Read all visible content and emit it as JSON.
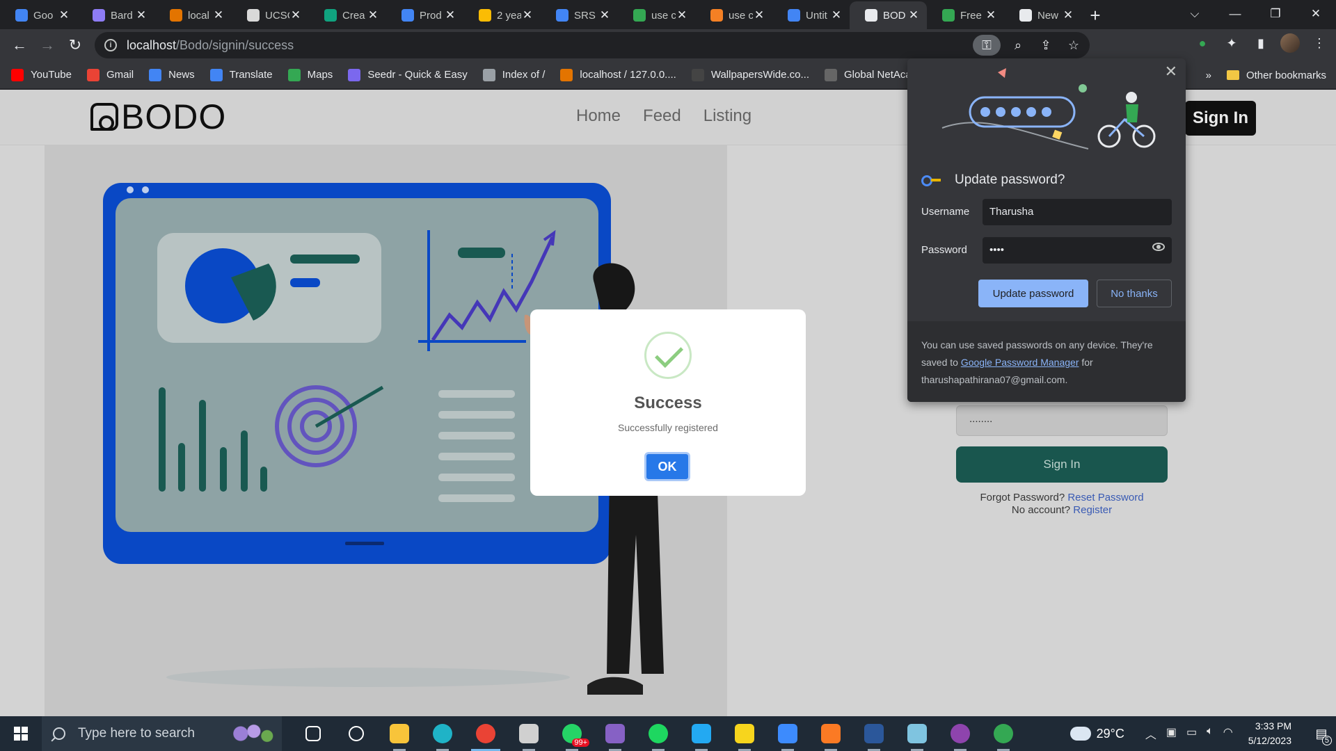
{
  "browser": {
    "tabs": [
      {
        "title": "Goo",
        "color": "#4285f4",
        "active": false
      },
      {
        "title": "Bard",
        "color": "#8e7cf5",
        "active": false
      },
      {
        "title": "local",
        "color": "#e37400",
        "active": false
      },
      {
        "title": "UCSC",
        "color": "#d9d9d9",
        "active": false
      },
      {
        "title": "Crea",
        "color": "#10a37f",
        "active": false
      },
      {
        "title": "Prod",
        "color": "#4285f4",
        "active": false
      },
      {
        "title": "2 yea",
        "color": "#fbbc04",
        "active": false
      },
      {
        "title": "SRS",
        "color": "#4285f4",
        "active": false
      },
      {
        "title": "use c",
        "color": "#34a853",
        "active": false
      },
      {
        "title": "use c",
        "color": "#f48024",
        "active": false
      },
      {
        "title": "Untit",
        "color": "#4285f4",
        "active": false
      },
      {
        "title": "BOD",
        "color": "#e8eaed",
        "active": true
      },
      {
        "title": "Free",
        "color": "#34a853",
        "active": false
      },
      {
        "title": "New",
        "color": "#e8eaed",
        "active": false
      }
    ],
    "new_tab_icon": "+",
    "window_controls": {
      "tab_search": "⌵",
      "minimize": "—",
      "restore": "❐",
      "close": "✕"
    },
    "nav": {
      "back": "←",
      "forward": "→",
      "reload": "↻"
    },
    "url_host": "localhost",
    "url_path": "/Bodo/signin/success",
    "bookmarks": [
      {
        "label": "YouTube",
        "color": "#ff0000"
      },
      {
        "label": "Gmail",
        "color": "#ea4335"
      },
      {
        "label": "News",
        "color": "#4285f4"
      },
      {
        "label": "Translate",
        "color": "#4285f4"
      },
      {
        "label": "Maps",
        "color": "#34a853"
      },
      {
        "label": "Seedr - Quick & Easy",
        "color": "#7b68ee"
      },
      {
        "label": "Index of /",
        "color": "#9aa0a6"
      },
      {
        "label": "localhost / 127.0.0....",
        "color": "#e37400"
      },
      {
        "label": "WallpapersWide.co...",
        "color": "#444444"
      },
      {
        "label": "Global NetAcac",
        "color": "#666666"
      }
    ],
    "bookmarks_overflow": "»",
    "other_bookmarks": "Other bookmarks"
  },
  "site": {
    "logo": "BODO",
    "nav_links": [
      "Home",
      "Feed",
      "Listing"
    ],
    "signin_top": "Sign In",
    "password_masked": "........",
    "signin_button": "Sign In",
    "forgot_text": "Forgot Password?",
    "reset_link": "Reset Password",
    "no_account_text": "No account?",
    "register_link": "Register"
  },
  "modal": {
    "title": "Success",
    "message": "Successfully registered",
    "ok_label": "OK"
  },
  "password_popup": {
    "close": "✕",
    "title": "Update password?",
    "username_label": "Username",
    "username_value": "Tharusha",
    "password_label": "Password",
    "password_value": "••••",
    "update_button": "Update password",
    "no_thanks_button": "No thanks",
    "footer_pre": "You can use saved passwords on any device. They're saved to",
    "footer_link": "Google Password Manager",
    "footer_post": "for tharushapathirana07@gmail.com."
  },
  "taskbar": {
    "search_placeholder": "Type here to search",
    "apps": [
      {
        "name": "task-view",
        "color": "#ffffff"
      },
      {
        "name": "settings",
        "color": "#ffffff"
      },
      {
        "name": "file-explorer",
        "color": "#f8c43a"
      },
      {
        "name": "edge",
        "color": "#1fb3c7"
      },
      {
        "name": "chrome",
        "color": "#ea4335"
      },
      {
        "name": "unity",
        "color": "#d0d0d0"
      },
      {
        "name": "whatsapp",
        "color": "#25d366"
      },
      {
        "name": "visual-studio",
        "color": "#8661c5"
      },
      {
        "name": "spotify",
        "color": "#1ed760"
      },
      {
        "name": "vscode",
        "color": "#23a9f2"
      },
      {
        "name": "sticky-notes",
        "color": "#f7d51d"
      },
      {
        "name": "power-automate",
        "color": "#3d8bfd"
      },
      {
        "name": "xampp",
        "color": "#fb7a24"
      },
      {
        "name": "word",
        "color": "#2b579a"
      },
      {
        "name": "notepad",
        "color": "#7fc4e0"
      },
      {
        "name": "github-desktop",
        "color": "#8e44ad"
      },
      {
        "name": "chrome-profile",
        "color": "#34a853"
      }
    ],
    "whatsapp_badge": "99+",
    "temperature": "29°C",
    "time": "3:33 PM",
    "date": "5/12/2023",
    "notifications": "5"
  }
}
